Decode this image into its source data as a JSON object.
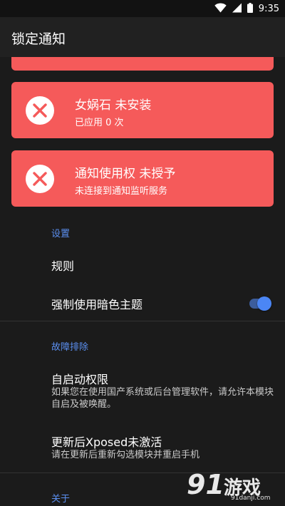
{
  "status_bar": {
    "time": "9:35"
  },
  "app_bar": {
    "title": "锁定通知"
  },
  "cards": [
    {
      "title": "女娲石 未安装",
      "subtitle": "已应用 0 次"
    },
    {
      "title": "通知使用权 未授予",
      "subtitle": "未连接到通知监听服务"
    }
  ],
  "settings": {
    "header": "设置",
    "rules_label": "规则",
    "dark_theme_label": "强制使用暗色主题",
    "dark_theme_enabled": true
  },
  "troubleshooting": {
    "header": "故障排除",
    "autostart_title": "自启动权限",
    "autostart_desc": "如果您在使用国产系统或后台管理软件，请允许本模块自启及被唤醒。",
    "xposed_title": "更新后Xposed未激活",
    "xposed_desc": "请在更新后重新勾选模块并重启手机"
  },
  "about": {
    "header": "关于"
  },
  "watermark": {
    "number": "91",
    "text": "游戏",
    "domain": "91danji.com"
  },
  "colors": {
    "card_red": "#f55a5a",
    "accent_blue": "#5b8ff0",
    "background": "#1b1b1b"
  }
}
